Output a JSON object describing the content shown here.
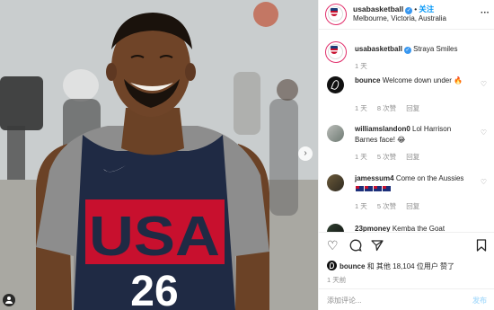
{
  "header": {
    "username": "usabasketball",
    "follow_label": "关注",
    "location": "Melbourne, Victoria, Australia",
    "more_label": "···"
  },
  "caption": {
    "username": "usabasketball",
    "text": "Strayа Smiles",
    "time": "1 天"
  },
  "comments": [
    {
      "username": "bounce",
      "text": "Welcome down under 🔥",
      "time": "1 天",
      "likes": "8 次赞",
      "reply": "回复"
    },
    {
      "username": "williamslandon0",
      "text": "Lol Harrison Barnes face! 😂",
      "time": "1 天",
      "likes": "5 次赞",
      "reply": "回复"
    },
    {
      "username": "jamessum4",
      "text": "Come on the Aussies",
      "time": "1 天",
      "likes": "5 次赞",
      "reply": "回复"
    },
    {
      "username": "23pmoney",
      "text": "Kemba the Goat"
    }
  ],
  "likes": {
    "liker": "bounce",
    "text": "和 其他 18,104 位用户 赞了"
  },
  "post_time": "1 天前",
  "add_comment": {
    "placeholder": "添加评论...",
    "post_label": "发布"
  },
  "photo": {
    "jersey_text": "USA",
    "jersey_number": "26"
  },
  "colors": {
    "accent": "#0095f6",
    "jersey_navy": "#1f2a44",
    "jersey_red": "#c8102e"
  }
}
